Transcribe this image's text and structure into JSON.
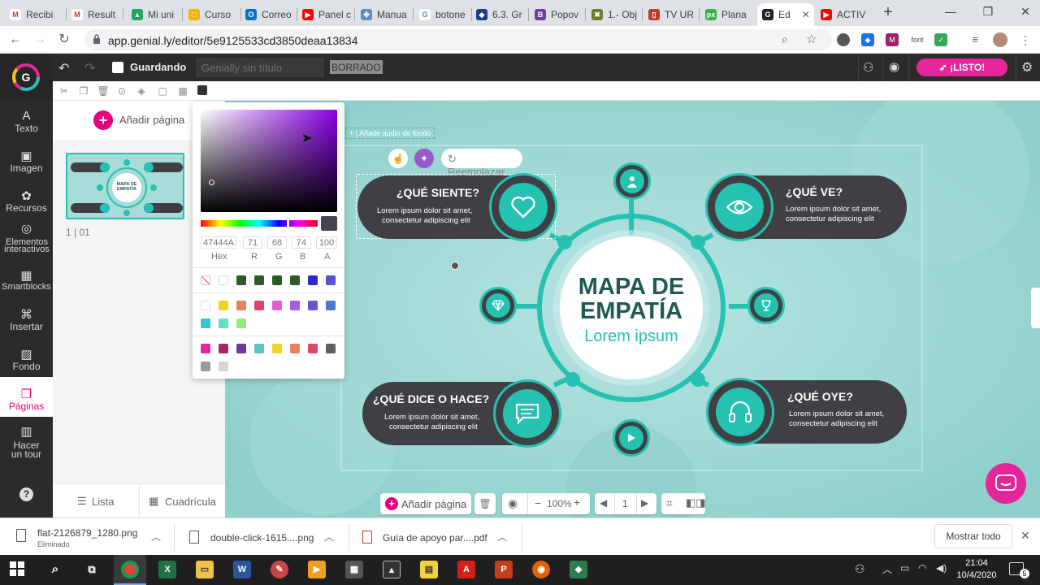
{
  "browser": {
    "tabs": [
      {
        "label": "Recibi",
        "fav": "M",
        "color": "#d93025"
      },
      {
        "label": "Result",
        "fav": "M",
        "color": "#d93025"
      },
      {
        "label": "Mi uni",
        "fav": "▲",
        "color": "#1fa463"
      },
      {
        "label": "Curso",
        "fav": "□",
        "color": "#f4b400"
      },
      {
        "label": "Correo",
        "fav": "O",
        "color": "#0072c6"
      },
      {
        "label": "Panel c",
        "fav": "▶",
        "color": "#ff0000"
      },
      {
        "label": "Manua",
        "fav": "✤",
        "color": "#5a8fbf"
      },
      {
        "label": "botone",
        "fav": "G",
        "color": "#4285f4"
      },
      {
        "label": "6.3. Gr",
        "fav": "◆",
        "color": "#1a3a8a"
      },
      {
        "label": "Popov",
        "fav": "B",
        "color": "#6b3fa0"
      },
      {
        "label": "1.- Obj",
        "fav": "✖",
        "color": "#6b7f2a"
      },
      {
        "label": "TV UR",
        "fav": "▯",
        "color": "#c0392b"
      },
      {
        "label": "Plana",
        "fav": "px",
        "color": "#38b24a"
      },
      {
        "label": "Ed",
        "fav": "G",
        "color": "#202124"
      },
      {
        "label": "ACTIV",
        "fav": "▶",
        "color": "#ff0000"
      }
    ],
    "url": "app.genial.ly/editor/5e9125533cd3850deaa13834",
    "font_ext_label": "font"
  },
  "header": {
    "saving_label": "Guardando",
    "title_placeholder": "Genially sin título",
    "draft_label": "BORRADO",
    "ready_label": "¡LISTO!"
  },
  "sidebar": {
    "items": [
      {
        "label": "Texto",
        "icon": "A"
      },
      {
        "label": "Imagen",
        "icon": "▣"
      },
      {
        "label": "Recursos",
        "icon": "✿"
      },
      {
        "label": "Elementos interactivos",
        "icon": "◎"
      },
      {
        "label": "Smartblocks",
        "icon": "▦"
      },
      {
        "label": "Insertar",
        "icon": "⌘"
      },
      {
        "label": "Fondo",
        "icon": "▨"
      },
      {
        "label": "Páginas",
        "icon": "❐"
      },
      {
        "label": "Hacer un tour",
        "icon": "▥"
      }
    ],
    "help_label": "?"
  },
  "pages_panel": {
    "add_page_label": "Añadir página",
    "page_counter": "1 | 01",
    "list_label": "Lista",
    "grid_label": "Cuadrícula",
    "thumb_title": "MAPA DE EMPATÍA"
  },
  "color_picker": {
    "hex": "47444A",
    "r": "71",
    "g": "68",
    "b": "74",
    "a": "100",
    "labels": {
      "hex": "Hex",
      "r": "R",
      "g": "G",
      "b": "B",
      "a": "A"
    },
    "current_color": "#47444a",
    "row1": [
      "#ffffff",
      "#2d5a27",
      "#2d5a27",
      "#2d5a27",
      "#2d5a27",
      "#2b2bc9",
      "#5b4fd6"
    ],
    "row2": [
      "#ffffff",
      "#f2d31b",
      "#e8825a",
      "#e0446a",
      "#e15fd2",
      "#a45fd9",
      "#6a55c9",
      "#4a78c6",
      "#37c4d4",
      "#5fe3c3",
      "#8ef07a"
    ],
    "row3": [
      "#e5299a",
      "#a3295f",
      "#6d3aa0",
      "#5ec4c2",
      "#f0d228",
      "#e8825a",
      "#e0446a",
      "#5f5f5f",
      "#9a9a9a",
      "#d6d6d6"
    ]
  },
  "canvas": {
    "audio_label": "Añade audio de fondo",
    "replace_label": "Reemplazar",
    "center_title_line1": "MAPA DE",
    "center_title_line2": "EMPATÍA",
    "center_subtitle": "Lorem ipsum",
    "cards": [
      {
        "title": "¿QUÉ SIENTE?",
        "body1": "Lorem ipsum dolor sit amet,",
        "body2": "consectetur adipiscing elit"
      },
      {
        "title": "¿QUÉ VE?",
        "body1": "Lorem ipsum dolor sit amet,",
        "body2": "consectetur adipiscing elit"
      },
      {
        "title": "¿QUÉ DICE O HACE?",
        "body1": "Lorem ipsum dolor sit amet,",
        "body2": "consectetur adipiscing elit"
      },
      {
        "title": "¿QUÉ OYE?",
        "body1": "Lorem ipsum dolor sit amet,",
        "body2": "consectetur adipiscing elit"
      }
    ],
    "accent": "#25c1b1",
    "card_color": "#3f3f44",
    "title_color": "#1f5a55"
  },
  "bottom_toolbar": {
    "add_page_label": "Añadir página",
    "zoom": "100%",
    "page": "1"
  },
  "downloads": {
    "items": [
      {
        "name": "flat-2126879_1280.png",
        "status": "Eliminado"
      },
      {
        "name": "double-click-1615....png",
        "status": ""
      },
      {
        "name": "Guía de apoyo par....pdf",
        "status": ""
      }
    ],
    "show_all_label": "Mostrar todo"
  },
  "taskbar": {
    "time": "21:04",
    "date": "10/4/2020",
    "notifications": "5"
  }
}
